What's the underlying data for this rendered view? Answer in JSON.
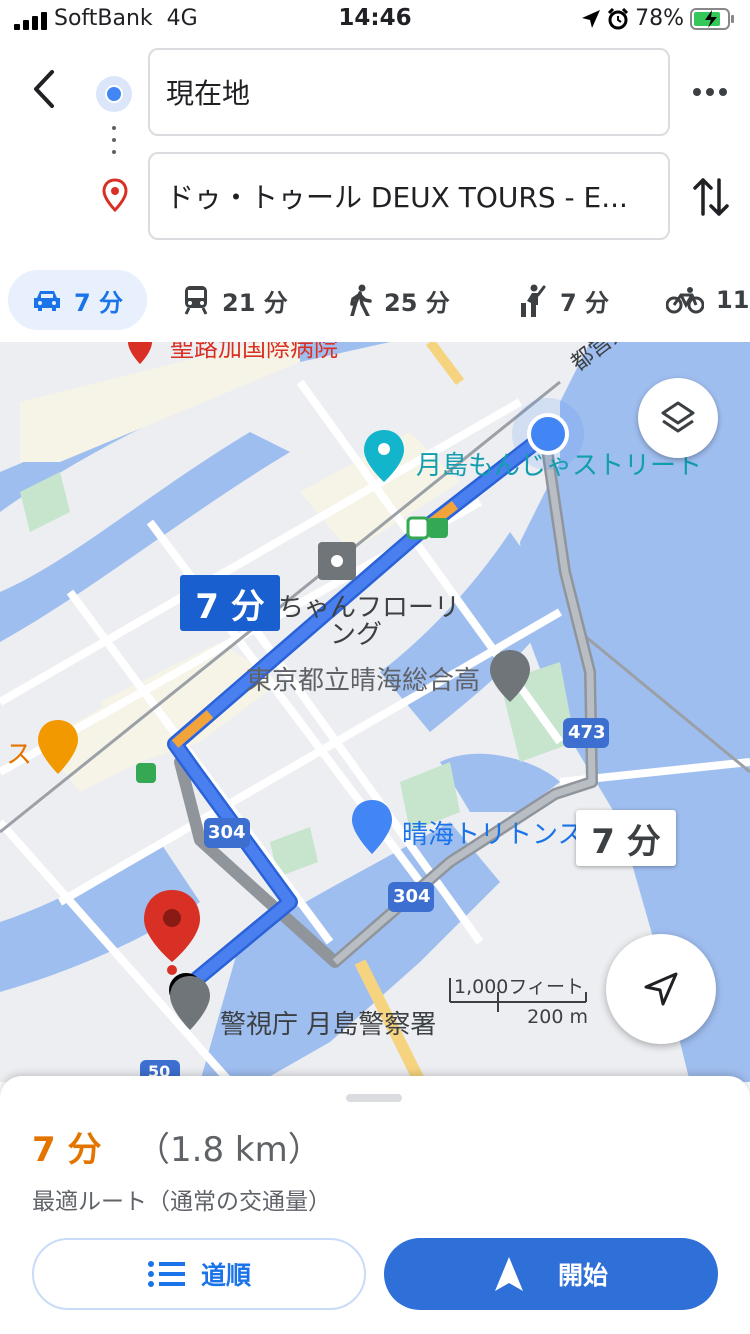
{
  "status_bar": {
    "carrier": "SoftBank",
    "network": "4G",
    "time": "14:46",
    "battery": "78%"
  },
  "search": {
    "origin": "現在地",
    "destination": "ドゥ・トゥール DEUX TOURS - E..."
  },
  "modes": [
    {
      "icon": "car-icon",
      "label": "7 分",
      "active": true
    },
    {
      "icon": "train-icon",
      "label": "21 分"
    },
    {
      "icon": "walk-icon",
      "label": "25 分"
    },
    {
      "icon": "ride-hail-icon",
      "label": "7 分"
    },
    {
      "icon": "bike-icon",
      "label": "11"
    }
  ],
  "map": {
    "route_time": "7 分",
    "alt_route_time": "7 分",
    "labels": {
      "street": "都営大",
      "monja": "月島もんじゃストリート",
      "flooring_1": "ちゃんフローリ",
      "flooring_2": "ング",
      "school": "東京都立晴海総合高",
      "triton": "晴海トリトンス",
      "police": "警視庁 月島警察署",
      "restaurant_fragment": "ス",
      "hospital_fragment": "聖路加国際病院"
    },
    "road_shields": [
      "304",
      "473",
      "304",
      "50"
    ],
    "scale": {
      "imperial": "1,000フィート",
      "metric": "200 m"
    }
  },
  "summary": {
    "time": "7 分",
    "distance": "（1.8 km）",
    "note": "最適ルート（通常の交通量）"
  },
  "actions": {
    "steps": "道順",
    "start": "開始"
  },
  "colors": {
    "accent": "#1a73e8",
    "route": "#4a7ff0",
    "eta": "#e37400",
    "water": "#9fbef0"
  }
}
